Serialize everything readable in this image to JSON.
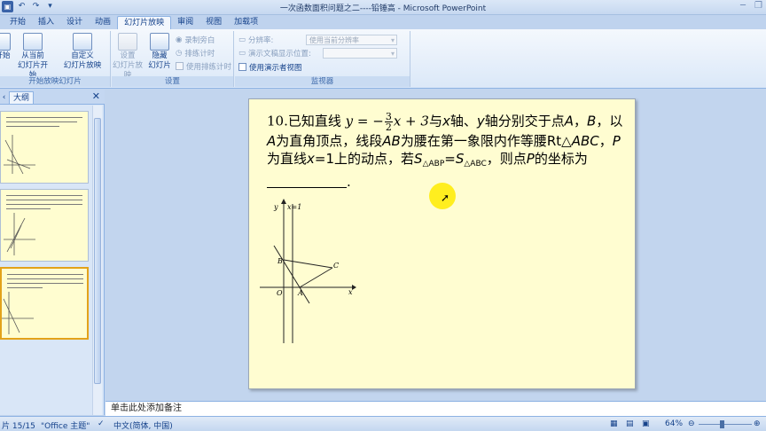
{
  "titlebar": {
    "title": "一次函数面积问题之二----铅锤高 - Microsoft PowerPoint"
  },
  "tabs": [
    {
      "label": "开始"
    },
    {
      "label": "插入"
    },
    {
      "label": "设计"
    },
    {
      "label": "动画"
    },
    {
      "label": "幻灯片放映"
    },
    {
      "label": "审阅"
    },
    {
      "label": "视图"
    },
    {
      "label": "加载项"
    }
  ],
  "ribbon": {
    "start_group": {
      "from_beginning": "开始",
      "from_current": "从当前",
      "from_current_2": "幻灯片开始",
      "custom": "自定义",
      "custom_2": "幻灯片放映",
      "label": "开始放映幻灯片"
    },
    "setup_group": {
      "setup": "设置",
      "setup_2": "幻灯片放映",
      "hide": "隐藏",
      "hide_2": "幻灯片",
      "record": "录制旁白",
      "rehearse": "排练计时",
      "use_timings": "使用排练计时",
      "label": "设置"
    },
    "monitor_group": {
      "resolution": "分辨率:",
      "resolution_value": "使用当前分辨率",
      "show_on": "演示文稿显示位置:",
      "presenter_view": "使用演示者视图",
      "label": "监视器"
    }
  },
  "left_panel": {
    "tab_outline": "大纲",
    "tab_slides": "‹",
    "close": "✕"
  },
  "slide": {
    "q_num": "10.",
    "t1": "已知直线",
    "y_eq": "y",
    "eq_sign": " = −",
    "frac_num": "3",
    "frac_den": "2",
    "x_plus": "x + 3",
    "t2": "与",
    "x1": "x",
    "t3": "轴、",
    "y1": "y",
    "t4": "轴分别交于点",
    "A1": "A",
    "comma1": "，",
    "B1": "B",
    "comma2": "，",
    "t5": "以",
    "A2": "A",
    "t6": "为直角顶点，线段",
    "AB": "AB",
    "t7": "为腰在第一象限内作等腰",
    "rt": "Rt△",
    "ABC1": "ABC",
    "comma3": "，",
    "P1": "P",
    "t8": "为直线",
    "x2": "x",
    "eq1": "=1",
    "t9": "上的动点，若",
    "S1": "S",
    "sub1": "△ABP",
    "eq2": "=",
    "S2": "S",
    "sub2": "△ABC",
    "t10": "，则",
    "t11": "点",
    "P2": "P",
    "t12": "的坐标为",
    "period": ".",
    "graph": {
      "label_y": "y",
      "label_x1": "x=1",
      "label_B": "B",
      "label_C": "C",
      "label_O": "O",
      "label_A": "A",
      "label_x": "x"
    }
  },
  "notes": {
    "placeholder": "单击此处添加备注"
  },
  "status": {
    "slide_count": "片 15/15",
    "theme": "\"Office 主题\"",
    "language": "中文(简体, 中国)",
    "zoom": "64%"
  }
}
